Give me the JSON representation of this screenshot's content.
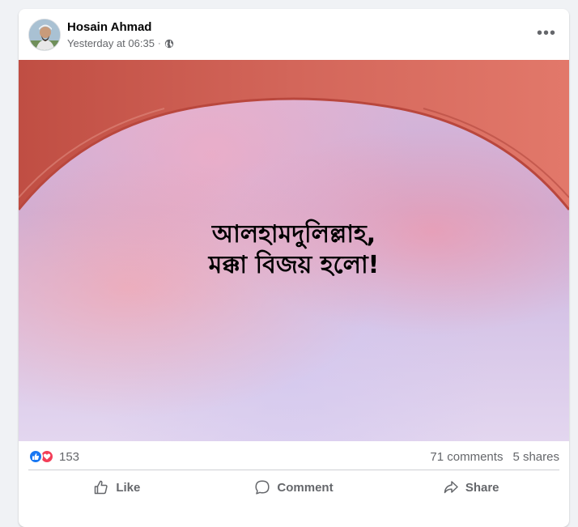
{
  "post": {
    "author": "Hosain Ahmad",
    "timestamp": "Yesterday at 06:35",
    "separator": "·",
    "audience_icon": "globe-icon",
    "more_label": "•••",
    "image_text_line1": "আলহামদুলিল্লাহ,",
    "image_text_line2": "মক্কা বিজয় হলো!"
  },
  "stats": {
    "reaction_icons": [
      "like-icon",
      "love-icon"
    ],
    "reaction_count": "153",
    "comments": "71 comments",
    "shares": "5 shares"
  },
  "actions": {
    "like": "Like",
    "comment": "Comment",
    "share": "Share"
  },
  "colors": {
    "like_blue": "#1877f2",
    "love_red": "#f33e58",
    "arch": "#c9564b",
    "secondary_text": "#65676b"
  }
}
